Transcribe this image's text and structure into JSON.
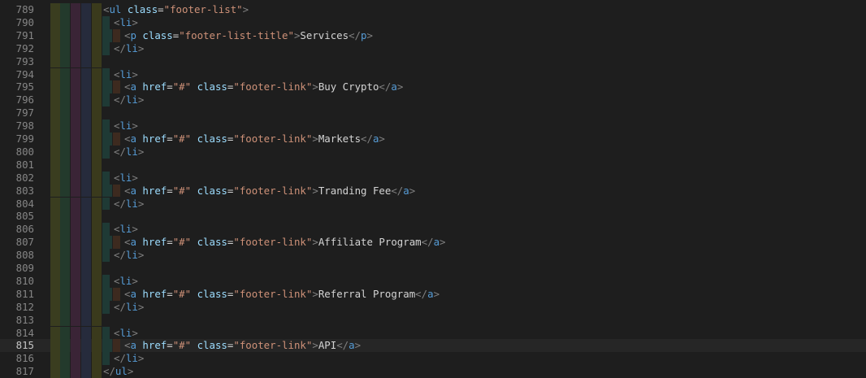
{
  "editor": {
    "theme": {
      "background": "#1e1e1e",
      "gutter_color": "#858585",
      "tag_color": "#569cd6",
      "bracket_color": "#808080",
      "attr_color": "#9cdcfe",
      "value_color": "#ce9178",
      "text_color": "#d4d4d4"
    },
    "current_line": "815",
    "lines": [
      {
        "num": "789",
        "indent": 0,
        "tokens": [
          [
            "b",
            "<"
          ],
          [
            "t",
            "ul"
          ],
          [
            "s",
            " "
          ],
          [
            "a",
            "class"
          ],
          [
            "e",
            "="
          ],
          [
            "v",
            "\"footer-list\""
          ],
          [
            "b",
            ">"
          ]
        ]
      },
      {
        "num": "790",
        "indent": 1,
        "tokens": [
          [
            "b",
            "<"
          ],
          [
            "t",
            "li"
          ],
          [
            "b",
            ">"
          ]
        ]
      },
      {
        "num": "791",
        "indent": 2,
        "tokens": [
          [
            "b",
            "<"
          ],
          [
            "t",
            "p"
          ],
          [
            "s",
            " "
          ],
          [
            "a",
            "class"
          ],
          [
            "e",
            "="
          ],
          [
            "v",
            "\"footer-list-title\""
          ],
          [
            "b",
            ">"
          ],
          [
            "x",
            "Services"
          ],
          [
            "b",
            "</"
          ],
          [
            "t",
            "p"
          ],
          [
            "b",
            ">"
          ]
        ]
      },
      {
        "num": "792",
        "indent": 1,
        "tokens": [
          [
            "b",
            "</"
          ],
          [
            "t",
            "li"
          ],
          [
            "b",
            ">"
          ]
        ]
      },
      {
        "num": "793",
        "indent": 0,
        "tokens": []
      },
      {
        "num": "794",
        "indent": 1,
        "tokens": [
          [
            "b",
            "<"
          ],
          [
            "t",
            "li"
          ],
          [
            "b",
            ">"
          ]
        ]
      },
      {
        "num": "795",
        "indent": 2,
        "tokens": [
          [
            "b",
            "<"
          ],
          [
            "t",
            "a"
          ],
          [
            "s",
            " "
          ],
          [
            "a",
            "href"
          ],
          [
            "e",
            "="
          ],
          [
            "v",
            "\"#\""
          ],
          [
            "s",
            " "
          ],
          [
            "a",
            "class"
          ],
          [
            "e",
            "="
          ],
          [
            "v",
            "\"footer-link\""
          ],
          [
            "b",
            ">"
          ],
          [
            "x",
            "Buy Crypto"
          ],
          [
            "b",
            "</"
          ],
          [
            "t",
            "a"
          ],
          [
            "b",
            ">"
          ]
        ]
      },
      {
        "num": "796",
        "indent": 1,
        "tokens": [
          [
            "b",
            "</"
          ],
          [
            "t",
            "li"
          ],
          [
            "b",
            ">"
          ]
        ]
      },
      {
        "num": "797",
        "indent": 0,
        "tokens": []
      },
      {
        "num": "798",
        "indent": 1,
        "tokens": [
          [
            "b",
            "<"
          ],
          [
            "t",
            "li"
          ],
          [
            "b",
            ">"
          ]
        ]
      },
      {
        "num": "799",
        "indent": 2,
        "tokens": [
          [
            "b",
            "<"
          ],
          [
            "t",
            "a"
          ],
          [
            "s",
            " "
          ],
          [
            "a",
            "href"
          ],
          [
            "e",
            "="
          ],
          [
            "v",
            "\"#\""
          ],
          [
            "s",
            " "
          ],
          [
            "a",
            "class"
          ],
          [
            "e",
            "="
          ],
          [
            "v",
            "\"footer-link\""
          ],
          [
            "b",
            ">"
          ],
          [
            "x",
            "Markets"
          ],
          [
            "b",
            "</"
          ],
          [
            "t",
            "a"
          ],
          [
            "b",
            ">"
          ]
        ]
      },
      {
        "num": "800",
        "indent": 1,
        "tokens": [
          [
            "b",
            "</"
          ],
          [
            "t",
            "li"
          ],
          [
            "b",
            ">"
          ]
        ]
      },
      {
        "num": "801",
        "indent": 0,
        "tokens": []
      },
      {
        "num": "802",
        "indent": 1,
        "tokens": [
          [
            "b",
            "<"
          ],
          [
            "t",
            "li"
          ],
          [
            "b",
            ">"
          ]
        ]
      },
      {
        "num": "803",
        "indent": 2,
        "tokens": [
          [
            "b",
            "<"
          ],
          [
            "t",
            "a"
          ],
          [
            "s",
            " "
          ],
          [
            "a",
            "href"
          ],
          [
            "e",
            "="
          ],
          [
            "v",
            "\"#\""
          ],
          [
            "s",
            " "
          ],
          [
            "a",
            "class"
          ],
          [
            "e",
            "="
          ],
          [
            "v",
            "\"footer-link\""
          ],
          [
            "b",
            ">"
          ],
          [
            "x",
            "Tranding Fee"
          ],
          [
            "b",
            "</"
          ],
          [
            "t",
            "a"
          ],
          [
            "b",
            ">"
          ]
        ]
      },
      {
        "num": "804",
        "indent": 1,
        "tokens": [
          [
            "b",
            "</"
          ],
          [
            "t",
            "li"
          ],
          [
            "b",
            ">"
          ]
        ]
      },
      {
        "num": "805",
        "indent": 0,
        "tokens": []
      },
      {
        "num": "806",
        "indent": 1,
        "tokens": [
          [
            "b",
            "<"
          ],
          [
            "t",
            "li"
          ],
          [
            "b",
            ">"
          ]
        ]
      },
      {
        "num": "807",
        "indent": 2,
        "tokens": [
          [
            "b",
            "<"
          ],
          [
            "t",
            "a"
          ],
          [
            "s",
            " "
          ],
          [
            "a",
            "href"
          ],
          [
            "e",
            "="
          ],
          [
            "v",
            "\"#\""
          ],
          [
            "s",
            " "
          ],
          [
            "a",
            "class"
          ],
          [
            "e",
            "="
          ],
          [
            "v",
            "\"footer-link\""
          ],
          [
            "b",
            ">"
          ],
          [
            "x",
            "Affiliate Program"
          ],
          [
            "b",
            "</"
          ],
          [
            "t",
            "a"
          ],
          [
            "b",
            ">"
          ]
        ]
      },
      {
        "num": "808",
        "indent": 1,
        "tokens": [
          [
            "b",
            "</"
          ],
          [
            "t",
            "li"
          ],
          [
            "b",
            ">"
          ]
        ]
      },
      {
        "num": "809",
        "indent": 0,
        "tokens": []
      },
      {
        "num": "810",
        "indent": 1,
        "tokens": [
          [
            "b",
            "<"
          ],
          [
            "t",
            "li"
          ],
          [
            "b",
            ">"
          ]
        ]
      },
      {
        "num": "811",
        "indent": 2,
        "tokens": [
          [
            "b",
            "<"
          ],
          [
            "t",
            "a"
          ],
          [
            "s",
            " "
          ],
          [
            "a",
            "href"
          ],
          [
            "e",
            "="
          ],
          [
            "v",
            "\"#\""
          ],
          [
            "s",
            " "
          ],
          [
            "a",
            "class"
          ],
          [
            "e",
            "="
          ],
          [
            "v",
            "\"footer-link\""
          ],
          [
            "b",
            ">"
          ],
          [
            "x",
            "Referral Program"
          ],
          [
            "b",
            "</"
          ],
          [
            "t",
            "a"
          ],
          [
            "b",
            ">"
          ]
        ]
      },
      {
        "num": "812",
        "indent": 1,
        "tokens": [
          [
            "b",
            "</"
          ],
          [
            "t",
            "li"
          ],
          [
            "b",
            ">"
          ]
        ]
      },
      {
        "num": "813",
        "indent": 0,
        "tokens": []
      },
      {
        "num": "814",
        "indent": 1,
        "tokens": [
          [
            "b",
            "<"
          ],
          [
            "t",
            "li"
          ],
          [
            "b",
            ">"
          ]
        ]
      },
      {
        "num": "815",
        "indent": 2,
        "tokens": [
          [
            "b",
            "<"
          ],
          [
            "t",
            "a"
          ],
          [
            "s",
            " "
          ],
          [
            "a",
            "href"
          ],
          [
            "e",
            "="
          ],
          [
            "v",
            "\"#\""
          ],
          [
            "s",
            " "
          ],
          [
            "a",
            "class"
          ],
          [
            "e",
            "="
          ],
          [
            "v",
            "\"footer-link\""
          ],
          [
            "b",
            ">"
          ],
          [
            "x",
            "API"
          ],
          [
            "b",
            "</"
          ],
          [
            "t",
            "a"
          ],
          [
            "b",
            ">"
          ]
        ]
      },
      {
        "num": "816",
        "indent": 1,
        "tokens": [
          [
            "b",
            "</"
          ],
          [
            "t",
            "li"
          ],
          [
            "b",
            ">"
          ]
        ]
      },
      {
        "num": "817",
        "indent": 0,
        "tokens": [
          [
            "b",
            "</"
          ],
          [
            "t",
            "ul"
          ],
          [
            "b",
            ">"
          ]
        ]
      }
    ],
    "guide_colors": [
      "#3a3d1f",
      "#233a2c",
      "#3a2436",
      "#262b3c",
      "#3a3a1c",
      "#1f3a35",
      "#3d2a1f"
    ]
  }
}
